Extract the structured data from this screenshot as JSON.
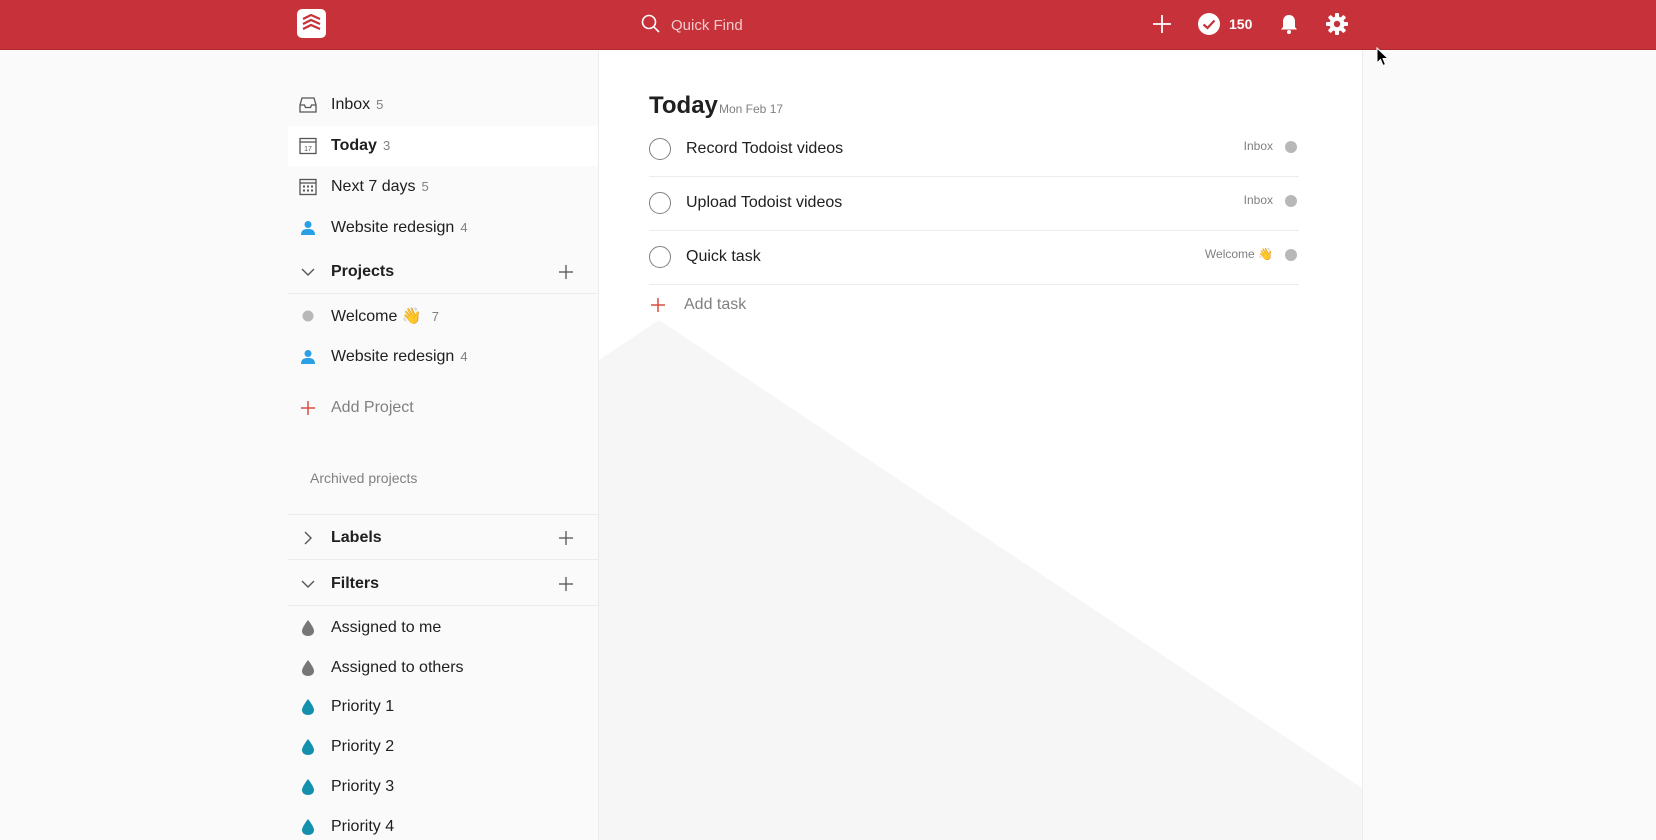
{
  "header": {
    "search_placeholder": "Quick Find",
    "karma": "150",
    "icons": [
      "todoist-logo-icon",
      "search-icon",
      "plus-icon",
      "karma-check-icon",
      "bell-icon",
      "gear-icon"
    ]
  },
  "sidebar": {
    "nav": [
      {
        "label": "Inbox",
        "count": "5",
        "icon": "inbox-icon"
      },
      {
        "label": "Today",
        "count": "3",
        "icon": "calendar-today-icon"
      },
      {
        "label": "Next 7 days",
        "count": "5",
        "icon": "calendar-week-icon"
      },
      {
        "label": "Website redesign",
        "count": "4",
        "icon": "person-icon"
      }
    ],
    "projects": {
      "title": "Projects",
      "items": [
        {
          "label": "Welcome 👋",
          "count": "7"
        },
        {
          "label": "Website redesign",
          "count": "4"
        }
      ],
      "add_label": "Add Project",
      "archived": "Archived projects"
    },
    "labels": {
      "title": "Labels"
    },
    "filters": {
      "title": "Filters",
      "items": [
        {
          "label": "Assigned to me"
        },
        {
          "label": "Assigned to others"
        },
        {
          "label": "Priority 1"
        },
        {
          "label": "Priority 2"
        },
        {
          "label": "Priority 3"
        },
        {
          "label": "Priority 4"
        }
      ]
    }
  },
  "main": {
    "title": "Today",
    "date": "Mon Feb 17",
    "tasks": [
      {
        "text": "Record Todoist videos",
        "project": "Inbox"
      },
      {
        "text": "Upload Todoist videos",
        "project": "Inbox"
      },
      {
        "text": "Quick task",
        "project": "Welcome 👋"
      }
    ],
    "add_task": "Add task"
  },
  "colors": {
    "brand": "#c7323a",
    "accent_red": "#db4c3f",
    "project_blue": "#299fe6",
    "filter_grey": "#777777",
    "filter_teal": "#14aaf5"
  }
}
